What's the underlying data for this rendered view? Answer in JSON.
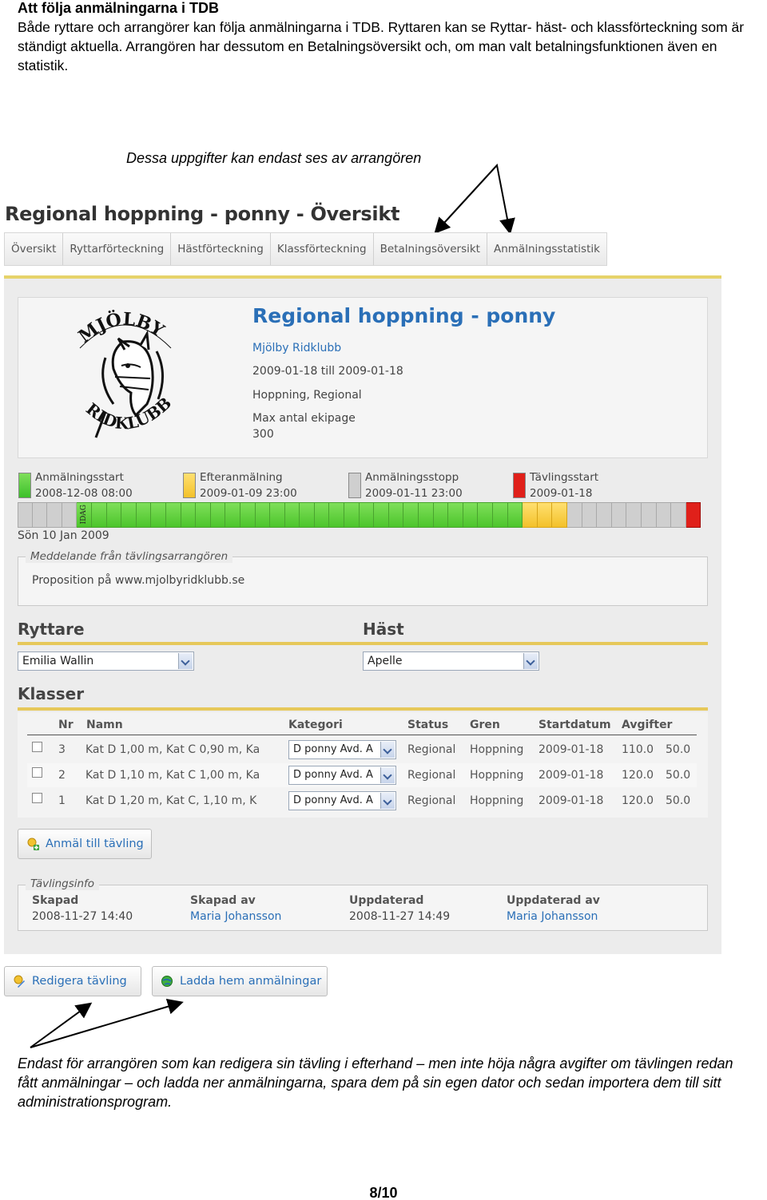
{
  "doc": {
    "heading": "Att följa anmälningarna i TDB",
    "paragraph": "Både ryttare och arrangörer kan följa anmälningarna i TDB. Ryttaren kan se Ryttar- häst- och klassförteckning som är ständigt aktuella. Arrangören har dessutom en Betalningsöversikt och, om man valt betalningsfunktionen även en statistik.",
    "note_top": "Dessa uppgifter kan endast ses av arrangören",
    "note_bottom": "Endast för arrangören som kan redigera sin tävling i efterhand – men inte höja några avgifter om tävlingen redan fått anmälningar – och ladda ner anmälningarna, spara dem på sin egen dator och sedan importera dem till sitt administrationsprogram.",
    "page_number": "8/10"
  },
  "app": {
    "title": "Regional hoppning - ponny - Översikt",
    "tabs": [
      "Översikt",
      "Ryttarförteckning",
      "Hästförteckning",
      "Klassförteckning",
      "Betalningsöversikt",
      "Anmälningsstatistik"
    ],
    "logo": {
      "top_text": "MJÖLBY",
      "bottom_text": "RIDKLUBB"
    },
    "event": {
      "title": "Regional hoppning - ponny",
      "club": "Mjölby Ridklubb",
      "dates": "2009-01-18 till 2009-01-18",
      "type": "Hoppning, Regional",
      "max_label": "Max antal ekipage",
      "max_value": "300"
    },
    "phases": [
      {
        "label": "Anmälningsstart",
        "date": "2008-12-08 08:00",
        "color": "#3cc02a"
      },
      {
        "label": "Efteranmälning",
        "date": "2009-01-09 23:00",
        "color": "#f3c12a"
      },
      {
        "label": "Anmälningsstopp",
        "date": "2009-01-11 23:00",
        "color": "#cfcfcf"
      },
      {
        "label": "Tävlingsstart",
        "date": "2009-01-18",
        "color": "#e0201a"
      }
    ],
    "timeline": {
      "cells": [
        "x",
        "x",
        "x",
        "x",
        "g",
        "g",
        "g",
        "g",
        "g",
        "g",
        "g",
        "g",
        "g",
        "g",
        "g",
        "g",
        "g",
        "g",
        "g",
        "g",
        "g",
        "g",
        "g",
        "g",
        "g",
        "g",
        "g",
        "g",
        "g",
        "g",
        "g",
        "g",
        "g",
        "g",
        "y",
        "y",
        "y",
        "x",
        "x",
        "x",
        "x",
        "x",
        "x",
        "x",
        "x",
        "r"
      ],
      "today_label": "IDAG",
      "today_index": 4,
      "date_label": "Sön 10 Jan 2009"
    },
    "message": {
      "legend": "Meddelande från tävlingsarrangören",
      "text": "Proposition på www.mjolbyridklubb.se"
    },
    "rider": {
      "heading": "Ryttare",
      "value": "Emilia Wallin"
    },
    "horse": {
      "heading": "Häst",
      "value": "Apelle"
    },
    "classes": {
      "heading": "Klasser",
      "columns": [
        "Nr",
        "Namn",
        "Kategori",
        "Status",
        "Gren",
        "Startdatum",
        "Avgifter"
      ],
      "rows": [
        {
          "nr": "3",
          "name": "Kat D 1,00 m, Kat C 0,90 m, Ka",
          "category": "D ponny Avd. A",
          "status": "Regional",
          "branch": "Hoppning",
          "start": "2009-01-18",
          "fee1": "110.0",
          "fee2": "50.0"
        },
        {
          "nr": "2",
          "name": "Kat D 1,10 m, Kat C 1,00 m, Ka",
          "category": "D ponny Avd. A",
          "status": "Regional",
          "branch": "Hoppning",
          "start": "2009-01-18",
          "fee1": "120.0",
          "fee2": "50.0"
        },
        {
          "nr": "1",
          "name": "Kat D 1,20 m, Kat C, 1,10 m, K",
          "category": "D ponny Avd. A",
          "status": "Regional",
          "branch": "Hoppning",
          "start": "2009-01-18",
          "fee1": "120.0",
          "fee2": "50.0"
        }
      ]
    },
    "register_button": "Anmäl till tävling",
    "info": {
      "legend": "Tävlingsinfo",
      "items": [
        {
          "label": "Skapad",
          "value": "2008-11-27 14:40"
        },
        {
          "label": "Skapad av",
          "value": "Maria Johansson"
        },
        {
          "label": "Uppdaterad",
          "value": "2008-11-27 14:49"
        },
        {
          "label": "Uppdaterad av",
          "value": "Maria Johansson"
        }
      ]
    },
    "edit_button": "Redigera tävling",
    "download_button": "Ladda hem anmälningar"
  }
}
